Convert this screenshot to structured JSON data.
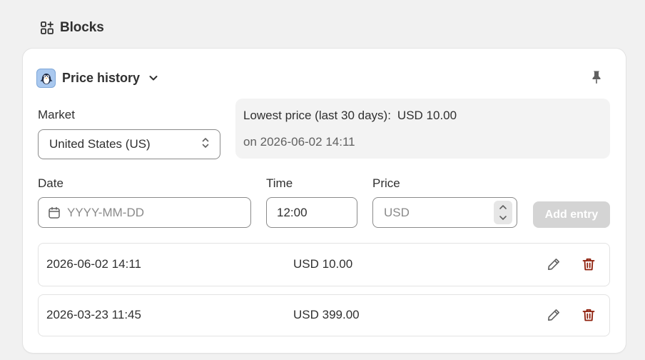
{
  "section": {
    "title": "Blocks",
    "icon": "blocks-icon"
  },
  "block": {
    "title": "Price history",
    "app_icon": "penguin-app-icon",
    "pin_icon": "pin-icon"
  },
  "market": {
    "label": "Market",
    "selected": "United States (US)"
  },
  "lowest_price": {
    "label": "Lowest price (last 30 days):",
    "value": "USD 10.00",
    "date": "on 2026-06-02 14:11"
  },
  "form": {
    "date_label": "Date",
    "date_placeholder": "YYYY-MM-DD",
    "time_label": "Time",
    "time_value": "12:00",
    "price_label": "Price",
    "price_placeholder": "USD",
    "add_button": "Add entry"
  },
  "entries": [
    {
      "date": "2026-06-02 14:11",
      "price": "USD 10.00"
    },
    {
      "date": "2026-03-23 11:45",
      "price": "USD 399.00"
    }
  ],
  "colors": {
    "accent_delete": "#8e1f0b",
    "disabled_button": "#d4d4d4",
    "text": "#303030"
  }
}
